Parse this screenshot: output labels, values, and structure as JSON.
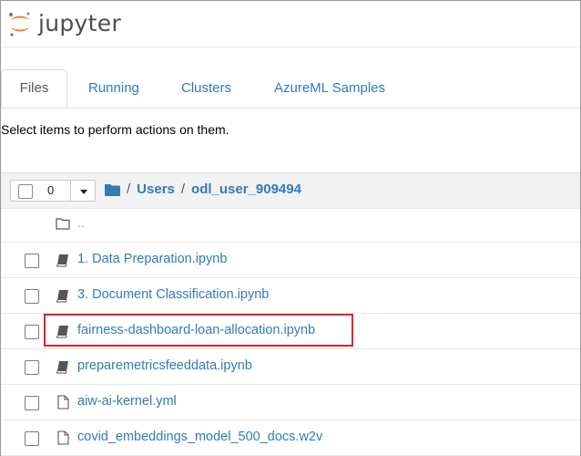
{
  "header": {
    "logo_text": "jupyter"
  },
  "tabs": [
    {
      "label": "Files",
      "active": true
    },
    {
      "label": "Running",
      "active": false
    },
    {
      "label": "Clusters",
      "active": false
    },
    {
      "label": "AzureML Samples",
      "active": false
    }
  ],
  "instructions": "Select items to perform actions on them.",
  "toolbar": {
    "selected_count": "0"
  },
  "breadcrumb": {
    "root_sep": "/",
    "items": [
      "Users",
      "odl_user_909494"
    ]
  },
  "files": [
    {
      "name": "..",
      "type": "folder"
    },
    {
      "name": "1. Data Preparation.ipynb",
      "type": "notebook"
    },
    {
      "name": "3. Document Classification.ipynb",
      "type": "notebook"
    },
    {
      "name": "fairness-dashboard-loan-allocation.ipynb",
      "type": "notebook",
      "highlighted": true
    },
    {
      "name": "preparemetricsfeeddata.ipynb",
      "type": "notebook"
    },
    {
      "name": "aiw-ai-kernel.yml",
      "type": "file"
    },
    {
      "name": "covid_embeddings_model_500_docs.w2v",
      "type": "file"
    }
  ],
  "colors": {
    "link": "#337ab7",
    "highlight": "#d9262b",
    "logo_orange": "#f37726"
  }
}
